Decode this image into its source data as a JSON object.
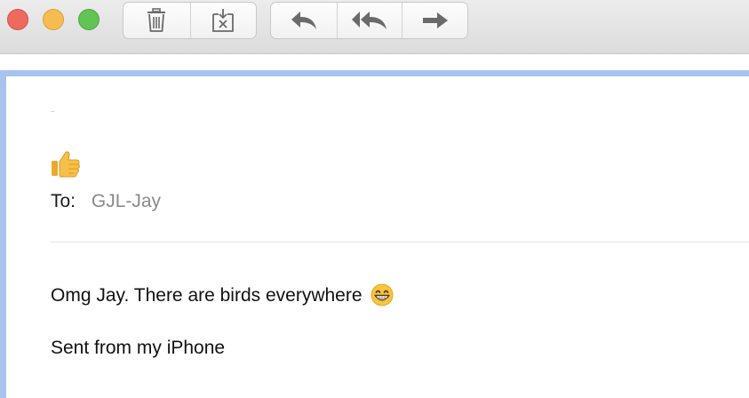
{
  "toolbar": {
    "buttons": [
      {
        "icon": "trash-icon"
      },
      {
        "icon": "junk-icon"
      },
      {
        "icon": "reply-icon"
      },
      {
        "icon": "reply-all-icon"
      },
      {
        "icon": "forward-icon"
      }
    ]
  },
  "message": {
    "subject_icon": "thumbs-up-emoji",
    "to_label": "To:",
    "to_value": "GJL-Jay",
    "body_line_1": "Omg Jay. There are birds everywhere",
    "body_line_1_emoji": "grinning-face-emoji",
    "body_line_2": "Sent from my iPhone"
  },
  "colors": {
    "close": "#ee6a5e",
    "minimize": "#f5bd4f",
    "maximize": "#61c454",
    "accent_strip": "#a7c3ee",
    "recipient": "#8a8a8a"
  }
}
